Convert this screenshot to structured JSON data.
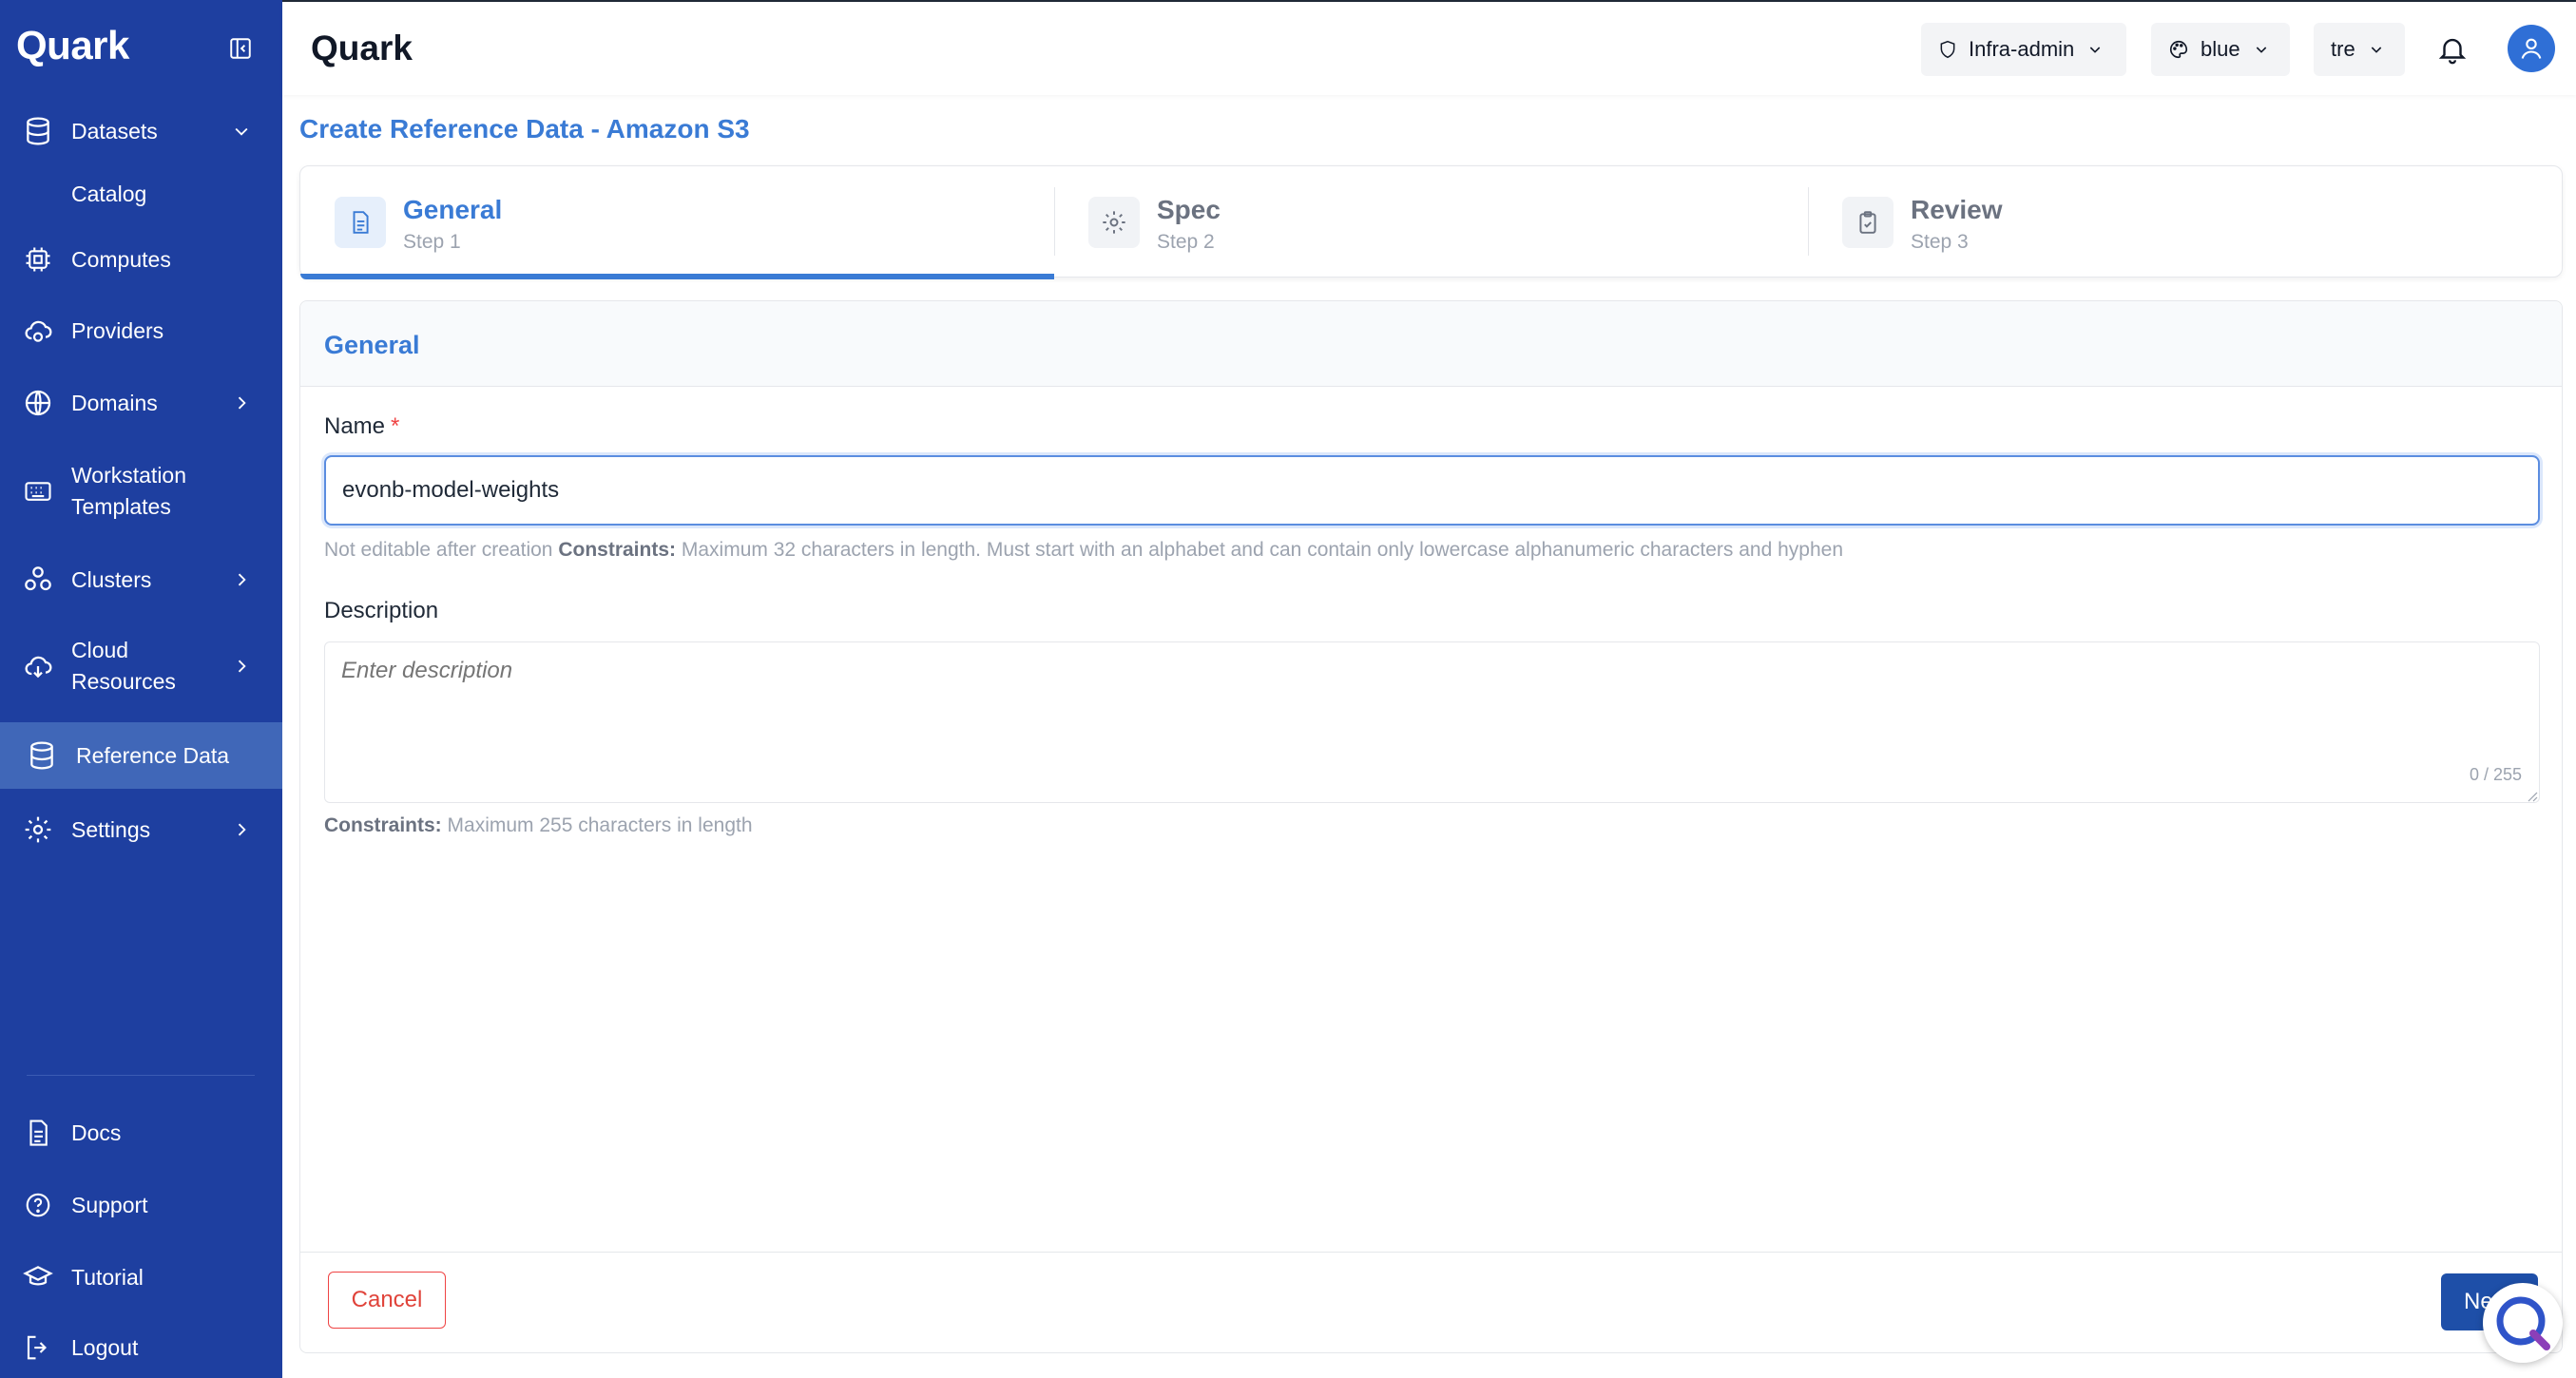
{
  "sidebar": {
    "brand": "Quark",
    "items": [
      {
        "label": "Datasets"
      },
      {
        "label": "Catalog"
      },
      {
        "label": "Computes"
      },
      {
        "label": "Providers"
      },
      {
        "label": "Domains"
      },
      {
        "label_line1": "Workstation",
        "label_line2": "Templates"
      },
      {
        "label": "Clusters"
      },
      {
        "label_line1": "Cloud",
        "label_line2": "Resources"
      },
      {
        "label": "Reference Data"
      },
      {
        "label": "Settings"
      }
    ],
    "bottom": [
      {
        "label": "Docs"
      },
      {
        "label": "Support"
      },
      {
        "label": "Tutorial"
      },
      {
        "label": "Logout"
      }
    ]
  },
  "header": {
    "title": "Quark",
    "role": "Infra-admin",
    "theme": "blue",
    "workspace": "tre"
  },
  "page": {
    "title": "Create Reference Data - Amazon S3"
  },
  "stepper": {
    "steps": [
      {
        "title": "General",
        "sub": "Step 1"
      },
      {
        "title": "Spec",
        "sub": "Step 2"
      },
      {
        "title": "Review",
        "sub": "Step 3"
      }
    ]
  },
  "form": {
    "section_title": "General",
    "name_label": "Name",
    "name_required": "*",
    "name_value": "evonb-model-weights",
    "name_help_prefix": "Not editable after creation",
    "name_help_bold": "Constraints:",
    "name_help_text": "Maximum 32 characters in length. Must start with an alphabet and can contain only lowercase alphanumeric characters and hyphen",
    "description_label": "Description",
    "description_placeholder": "Enter description",
    "description_counter": "0 / 255",
    "description_help_bold": "Constraints:",
    "description_help_text": "Maximum 255 characters in length",
    "cancel_label": "Cancel",
    "next_label": "Next"
  },
  "colors": {
    "sidebar_bg": "#1e3fa0",
    "sidebar_active": "#4067b8",
    "accent": "#3a7bd5",
    "danger": "#ef4444",
    "primary_button": "#1e4fa8"
  }
}
